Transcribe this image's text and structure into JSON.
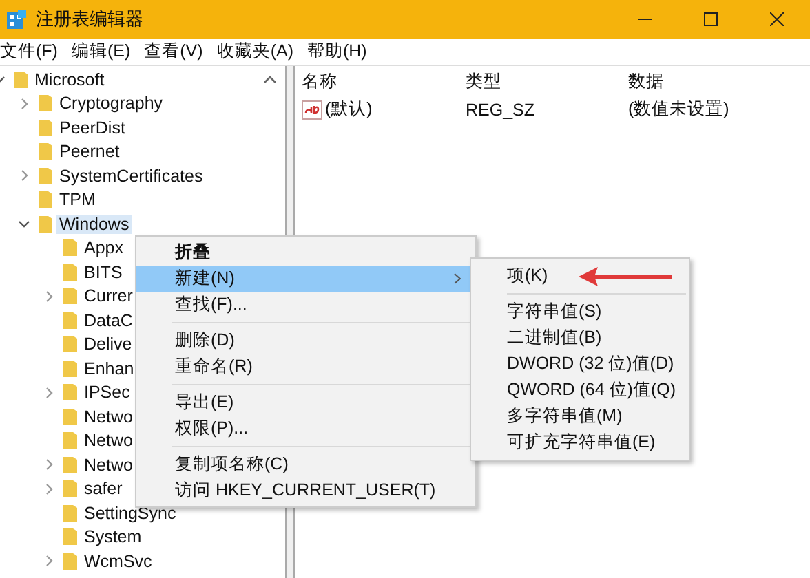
{
  "window": {
    "title": "注册表编辑器"
  },
  "menu_bar": [
    "文件(F)",
    "编辑(E)",
    "查看(V)",
    "收藏夹(A)",
    "帮助(H)"
  ],
  "tree": [
    {
      "label": "Microsoft",
      "expanded": true,
      "selected": false,
      "children": [
        {
          "label": "Cryptography",
          "expanded": false,
          "selected": false
        },
        {
          "label": "PeerDist",
          "selected": false
        },
        {
          "label": "Peernet",
          "selected": false
        },
        {
          "label": "SystemCertificates",
          "expanded": false,
          "selected": false
        },
        {
          "label": "TPM",
          "selected": false
        },
        {
          "label": "Windows",
          "expanded": true,
          "selected": true,
          "children": [
            {
              "label": "Appx",
              "selected": false
            },
            {
              "label": "BITS",
              "selected": false
            },
            {
              "label": "Currer",
              "expanded": false,
              "selected": false
            },
            {
              "label": "DataC",
              "selected": false
            },
            {
              "label": "Delive",
              "selected": false
            },
            {
              "label": "Enhan",
              "selected": false
            },
            {
              "label": "IPSec",
              "expanded": false,
              "selected": false
            },
            {
              "label": "Netwo",
              "selected": false
            },
            {
              "label": "Netwo",
              "selected": false
            },
            {
              "label": "Netwo",
              "expanded": false,
              "selected": false
            },
            {
              "label": "safer",
              "expanded": false,
              "selected": false
            },
            {
              "label": "SettingSync",
              "selected": false
            },
            {
              "label": "System",
              "selected": false
            },
            {
              "label": "WcmSvc",
              "expanded": false,
              "selected": false
            }
          ]
        }
      ]
    }
  ],
  "values_table": {
    "columns": [
      "名称",
      "类型",
      "数据"
    ],
    "rows": [
      {
        "name": "(默认)",
        "type": "REG_SZ",
        "data": "(数值未设置)"
      }
    ]
  },
  "context_menu": [
    {
      "kind": "item",
      "label": "折叠",
      "default": true,
      "selected": false,
      "submenu": false
    },
    {
      "kind": "item",
      "label": "新建(N)",
      "default": false,
      "selected": true,
      "submenu": true
    },
    {
      "kind": "item",
      "label": "查找(F)...",
      "default": false,
      "selected": false,
      "submenu": false
    },
    {
      "kind": "separator"
    },
    {
      "kind": "item",
      "label": "删除(D)",
      "default": false,
      "selected": false,
      "submenu": false
    },
    {
      "kind": "item",
      "label": "重命名(R)",
      "default": false,
      "selected": false,
      "submenu": false
    },
    {
      "kind": "separator"
    },
    {
      "kind": "item",
      "label": "导出(E)",
      "default": false,
      "selected": false,
      "submenu": false
    },
    {
      "kind": "item",
      "label": "权限(P)...",
      "default": false,
      "selected": false,
      "submenu": false
    },
    {
      "kind": "separator"
    },
    {
      "kind": "item",
      "label": "复制项名称(C)",
      "default": false,
      "selected": false,
      "submenu": false
    },
    {
      "kind": "item",
      "label": "访问 HKEY_CURRENT_USER(T)",
      "default": false,
      "selected": false,
      "submenu": false
    }
  ],
  "submenu": [
    {
      "kind": "item",
      "label": "项(K)"
    },
    {
      "kind": "separator"
    },
    {
      "kind": "item",
      "label": "字符串值(S)"
    },
    {
      "kind": "item",
      "label": "二进制值(B)"
    },
    {
      "kind": "item",
      "label": "DWORD (32 位)值(D)"
    },
    {
      "kind": "item",
      "label": "QWORD (64 位)值(Q)"
    },
    {
      "kind": "item",
      "label": "多字符串值(M)"
    },
    {
      "kind": "item",
      "label": "可扩充字符串值(E)"
    }
  ]
}
